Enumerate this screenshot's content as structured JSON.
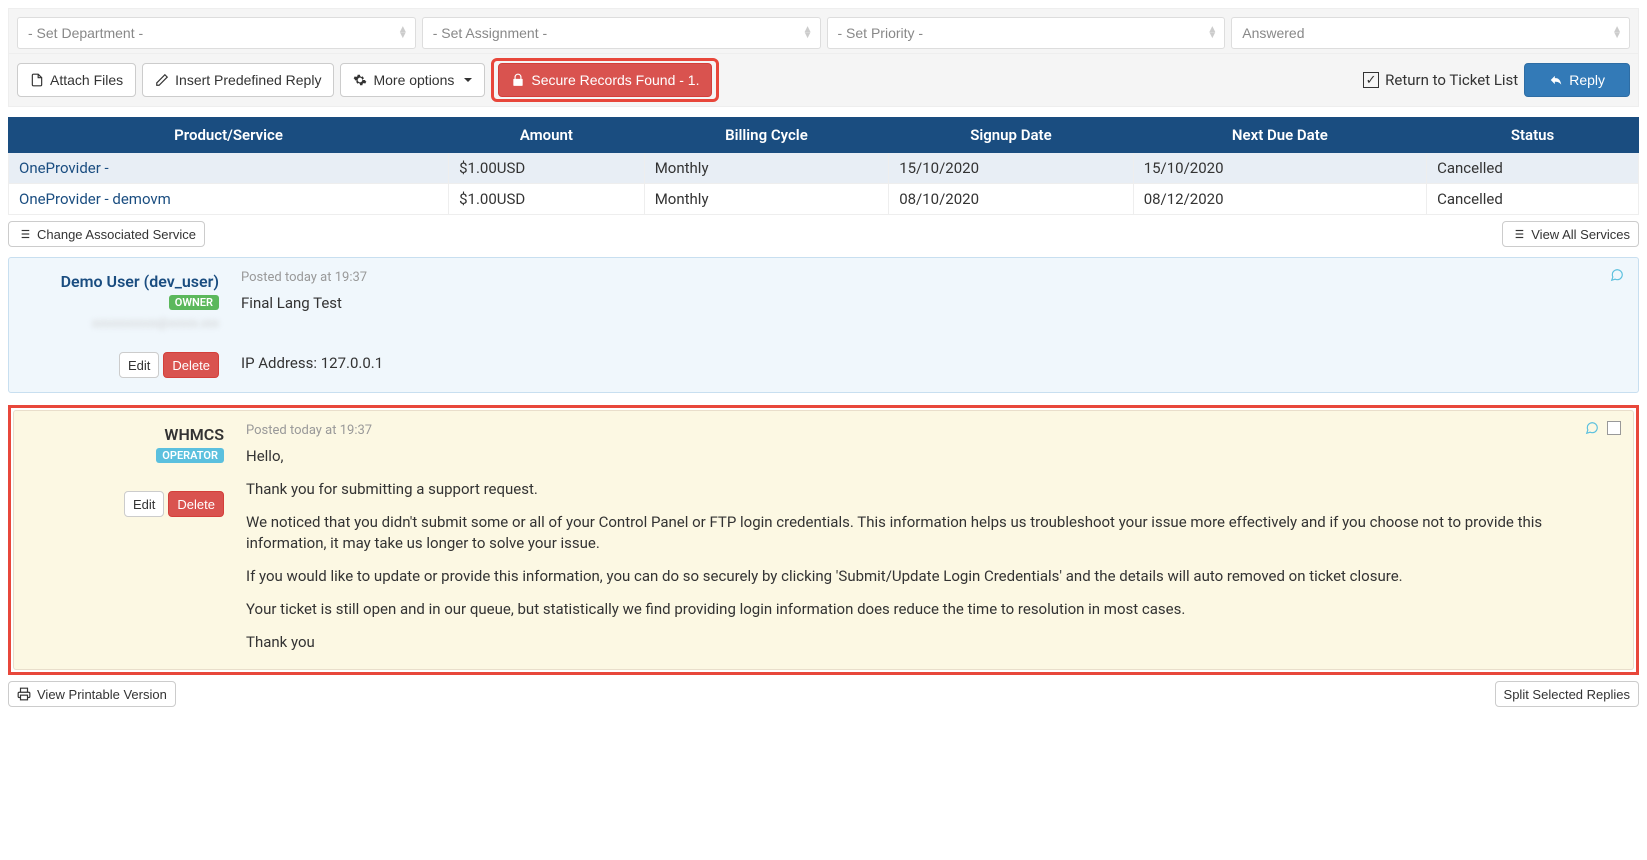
{
  "toolbar": {
    "department_placeholder": "- Set Department -",
    "assignment_placeholder": "- Set Assignment -",
    "priority_placeholder": "- Set Priority -",
    "status_value": "Answered",
    "attach_files": "Attach Files",
    "insert_predefined": "Insert Predefined Reply",
    "more_options": "More options",
    "secure_records": "Secure Records Found - 1.",
    "return_to_list": "Return to Ticket List",
    "reply": "Reply"
  },
  "services": {
    "headers": {
      "product": "Product/Service",
      "amount": "Amount",
      "cycle": "Billing Cycle",
      "signup": "Signup Date",
      "due": "Next Due Date",
      "status": "Status"
    },
    "rows": [
      {
        "product": "OneProvider -",
        "amount": "$1.00USD",
        "cycle": "Monthly",
        "signup": "15/10/2020",
        "due": "15/10/2020",
        "status": "Cancelled"
      },
      {
        "product": "OneProvider - demovm",
        "amount": "$1.00USD",
        "cycle": "Monthly",
        "signup": "08/10/2020",
        "due": "08/12/2020",
        "status": "Cancelled"
      }
    ],
    "change_assoc": "Change Associated Service",
    "view_all": "View All Services"
  },
  "posts": [
    {
      "author": "Demo User (dev_user)",
      "badge": "OWNER",
      "posted": "Posted today at 19:37",
      "body_lines": [
        "Final Lang Test"
      ],
      "ip": "IP Address: 127.0.0.1",
      "edit": "Edit",
      "delete": "Delete"
    },
    {
      "author": "WHMCS",
      "badge": "OPERATOR",
      "posted": "Posted today at 19:37",
      "body_lines": [
        "Hello,",
        "Thank you for submitting a support request.",
        "We noticed that you didn't submit some or all of your Control Panel or FTP login credentials. This information helps us troubleshoot your issue more effectively and if you choose not to provide this information, it may take us longer to solve your issue.",
        "If you would like to update or provide this information, you can do so securely by clicking 'Submit/Update Login Credentials' and the details will auto removed on ticket closure.",
        "Your ticket is still open and in our queue, but statistically we find providing login information does reduce the time to resolution in most cases.",
        "Thank you"
      ],
      "edit": "Edit",
      "delete": "Delete"
    }
  ],
  "bottom": {
    "printable": "View Printable Version",
    "split": "Split Selected Replies"
  }
}
